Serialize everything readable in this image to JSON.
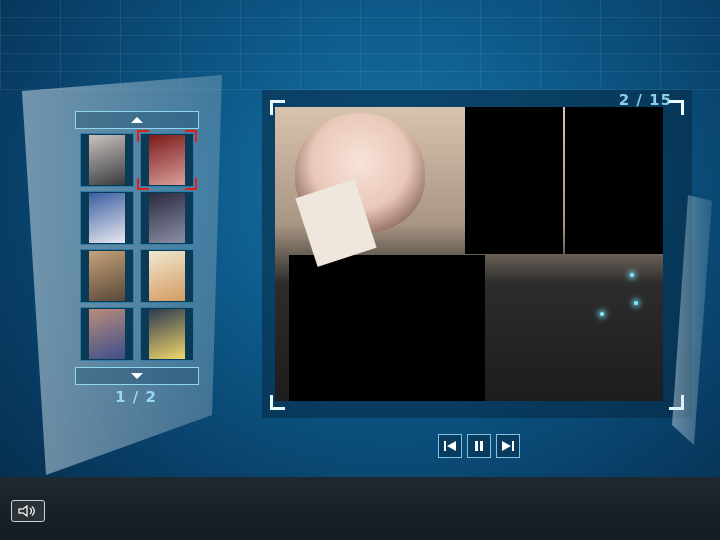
{
  "gallery": {
    "page_label": "1 / 2",
    "thumbnails": [
      {
        "name": "thumb-1",
        "selected": false,
        "colors": [
          "#c9c3c0",
          "#3a3b3d"
        ]
      },
      {
        "name": "thumb-2",
        "selected": true,
        "colors": [
          "#7a1a1a",
          "#d9a09a"
        ]
      },
      {
        "name": "thumb-3",
        "selected": false,
        "colors": [
          "#3b5fa0",
          "#e8e8f0"
        ]
      },
      {
        "name": "thumb-4",
        "selected": false,
        "colors": [
          "#2a2a40",
          "#8b8fa5"
        ]
      },
      {
        "name": "thumb-5",
        "selected": false,
        "colors": [
          "#c4a27a",
          "#5a4838"
        ]
      },
      {
        "name": "thumb-6",
        "selected": false,
        "colors": [
          "#efe8d0",
          "#d49b62"
        ]
      },
      {
        "name": "thumb-7",
        "selected": false,
        "colors": [
          "#b98c7a",
          "#3d4f8c"
        ]
      },
      {
        "name": "thumb-8",
        "selected": false,
        "colors": [
          "#2d3a4f",
          "#f1d76a"
        ]
      }
    ]
  },
  "viewer": {
    "counter": "2 / 15"
  },
  "controls": {
    "first_icon": "skip-to-first-icon",
    "pause_icon": "pause-icon",
    "last_icon": "skip-to-last-icon"
  },
  "footer": {
    "sound_icon": "speaker-icon"
  },
  "colors": {
    "accent": "#8ed7ef",
    "selection": "#e0201a",
    "background": "#0d5a8a"
  }
}
